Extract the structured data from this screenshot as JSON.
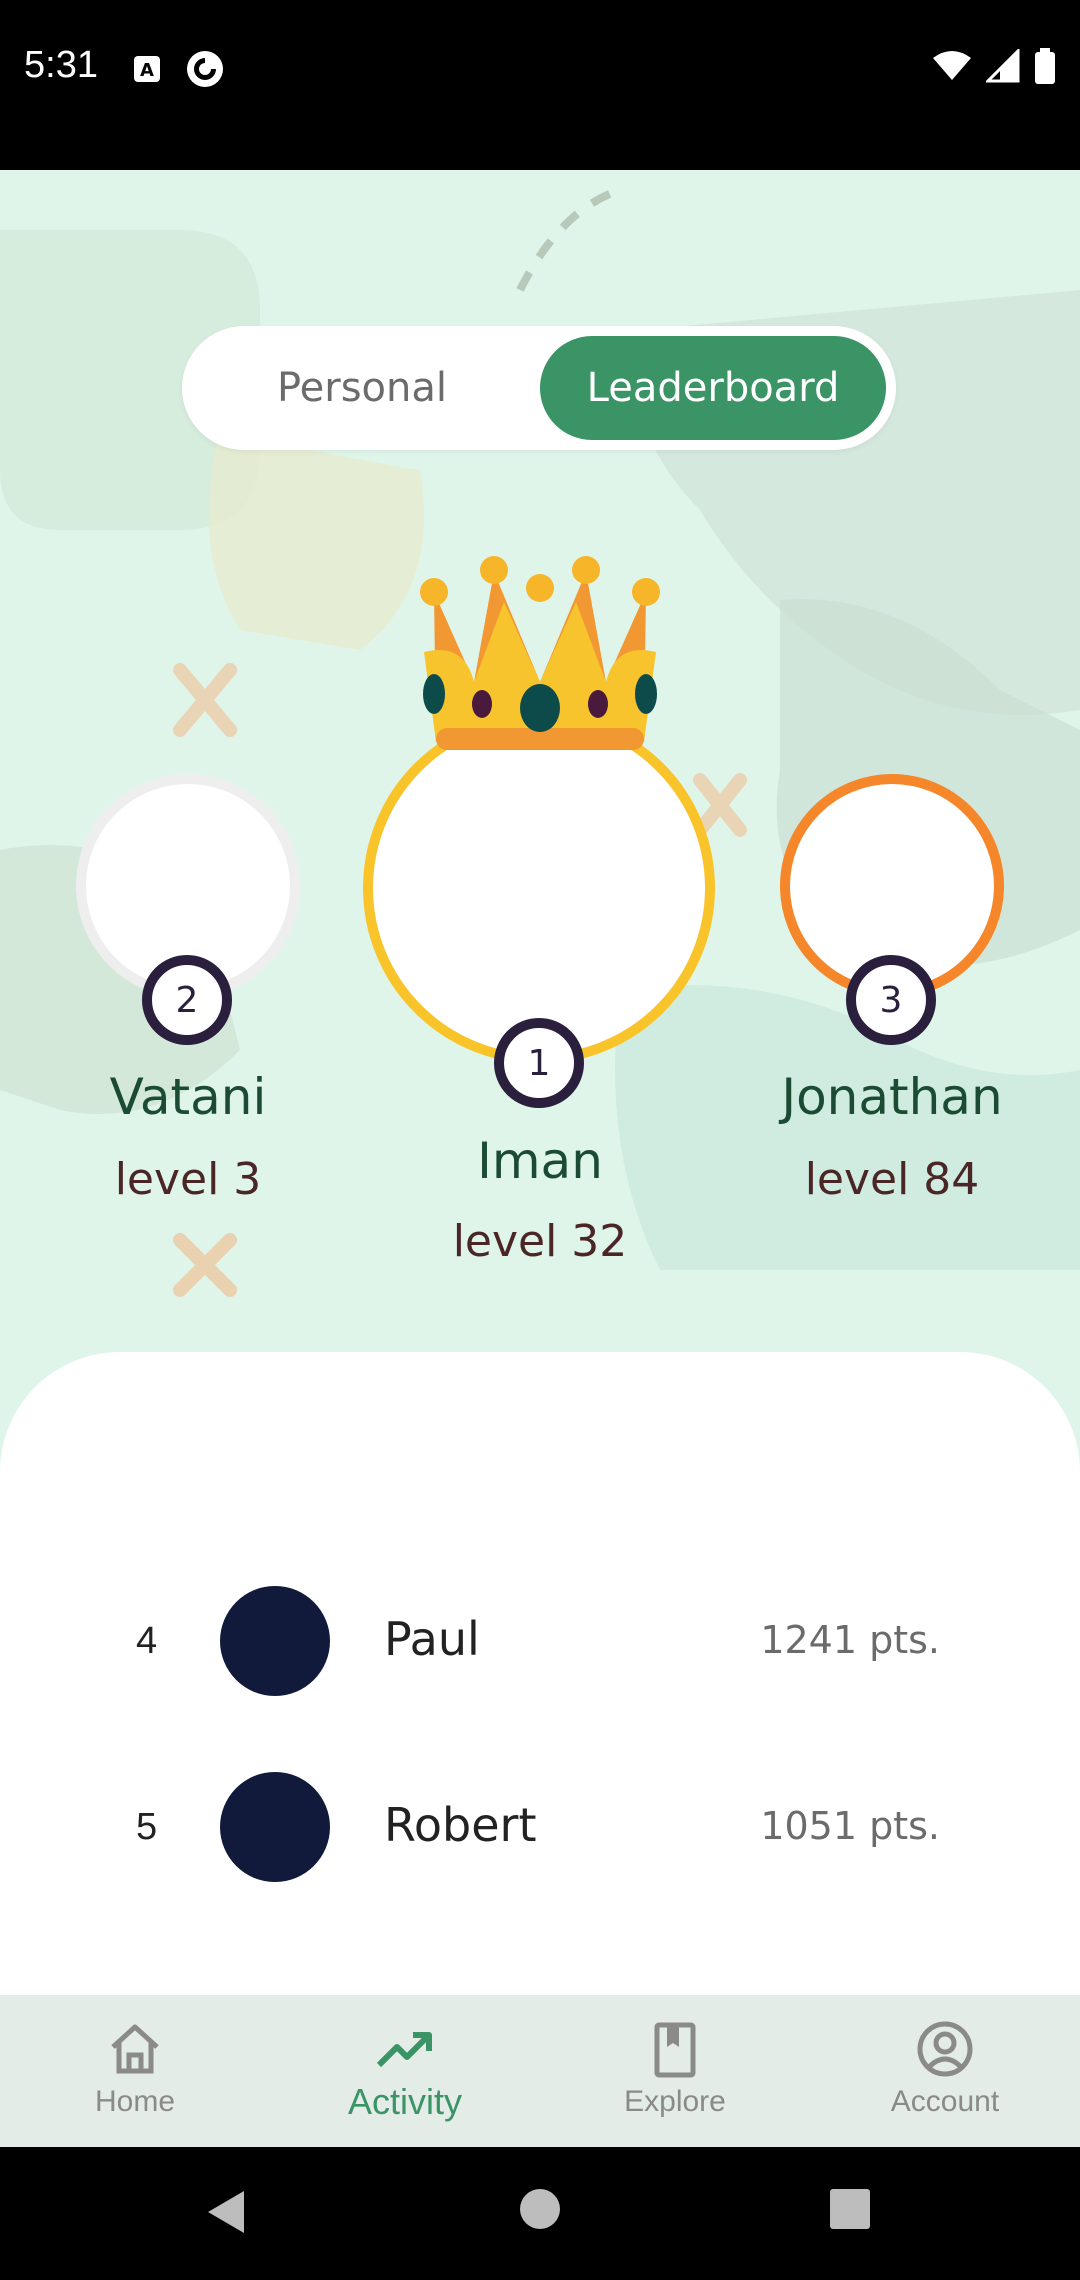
{
  "status_bar": {
    "time": "5:31",
    "left_icons": [
      "a-notification-icon",
      "pocket-casts-icon"
    ],
    "right_icons": [
      "wifi-icon",
      "cell-signal-icon",
      "battery-icon"
    ]
  },
  "toggle": {
    "personal_label": "Personal",
    "leaderboard_label": "Leaderboard",
    "selected": "Leaderboard",
    "accent_color": "#3a9466"
  },
  "podium": {
    "first": {
      "rank": "1",
      "name": "Iman",
      "level": "level 32",
      "ring_color": "#f9c32a"
    },
    "second": {
      "rank": "2",
      "name": "Vatani",
      "level": "level 3",
      "ring_color": "#eeeeee"
    },
    "third": {
      "rank": "3",
      "name": "Jonathan",
      "level": "level 84",
      "ring_color": "#f5862a"
    }
  },
  "list": [
    {
      "rank": "4",
      "name": "Paul",
      "points": "1241 pts."
    },
    {
      "rank": "5",
      "name": "Robert",
      "points": "1051 pts."
    }
  ],
  "bottom_nav": {
    "items": [
      {
        "label": "Home",
        "icon": "home-icon",
        "active": false
      },
      {
        "label": "Activity",
        "icon": "trending-up-icon",
        "active": true
      },
      {
        "label": "Explore",
        "icon": "book-icon",
        "active": false
      },
      {
        "label": "Account",
        "icon": "account-icon",
        "active": false
      }
    ]
  },
  "system_nav": [
    "back-icon",
    "home-circle-icon",
    "recents-icon"
  ]
}
